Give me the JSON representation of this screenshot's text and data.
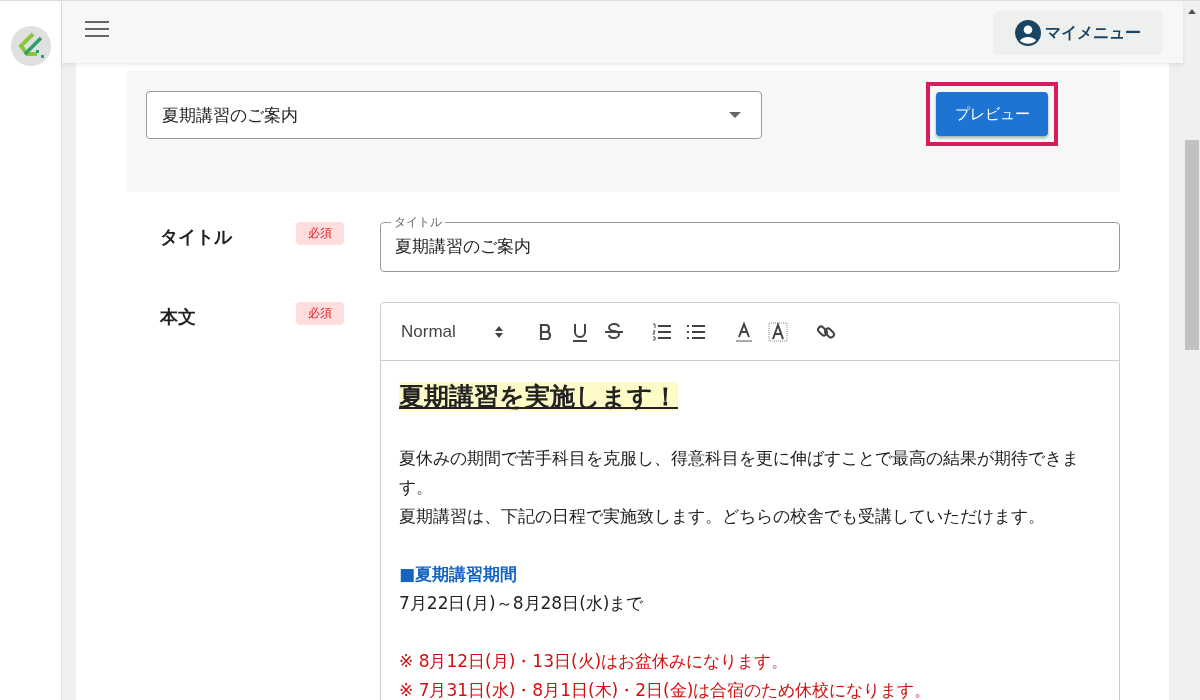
{
  "header": {
    "my_menu_label": "マイメニュー"
  },
  "template_select": {
    "value": "夏期講習のご案内"
  },
  "preview_button": {
    "label": "プレビュー",
    "highlighted": true
  },
  "fields": [
    {
      "label": "タイトル",
      "required_badge": "必須",
      "floating_label": "タイトル",
      "value": "夏期講習のご案内"
    },
    {
      "label": "本文",
      "required_badge": "必須"
    }
  ],
  "editor": {
    "format_select": "Normal",
    "paragraphs": [
      {
        "lines": [
          {
            "kind": "heading",
            "text": "夏期講習を実施します！"
          }
        ]
      },
      {
        "lines": [
          {
            "kind": "text",
            "text": "夏休みの期間で苦手科目を克服し、得意科目を更に伸ばすことで最高の結果が期待できます。"
          },
          {
            "kind": "text",
            "text": "夏期講習は、下記の日程で実施致します。どちらの校舎でも受講していただけます。"
          }
        ]
      },
      {
        "lines": [
          {
            "kind": "subheading",
            "text": "■夏期講習期間"
          },
          {
            "kind": "text",
            "text": "7月22日(月)～8月28日(水)まで"
          }
        ]
      },
      {
        "lines": [
          {
            "kind": "note",
            "text": "※ 8月12日(月)・13日(火)はお盆休みになります。"
          },
          {
            "kind": "note",
            "text": "※ 7月31日(水)・8月1日(木)・2日(金)は合宿のため休校になります。"
          }
        ]
      }
    ]
  }
}
